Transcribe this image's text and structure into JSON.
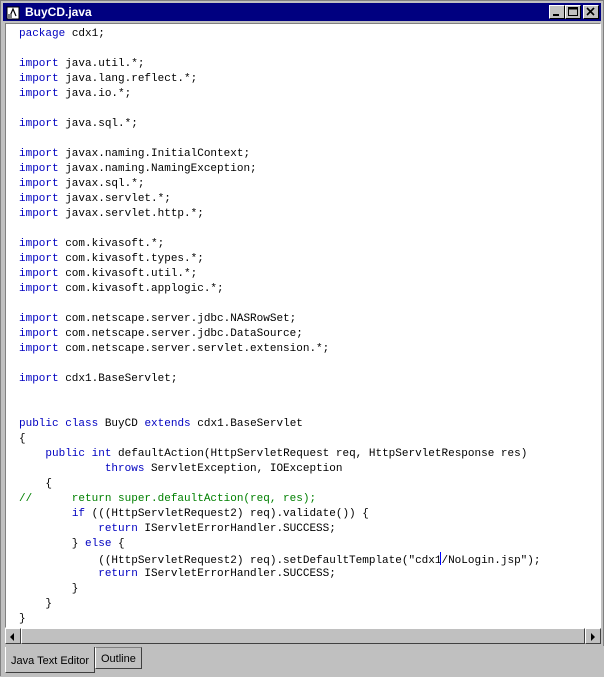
{
  "window": {
    "title": "BuyCD.java"
  },
  "tabs": [
    {
      "label": "Java Text Editor",
      "active": true
    },
    {
      "label": "Outline",
      "active": false
    }
  ],
  "code_lines": [
    [
      {
        "t": "package",
        "k": "kw"
      },
      {
        "t": " cdx1;"
      }
    ],
    [],
    [
      {
        "t": "import",
        "k": "kw"
      },
      {
        "t": " java.util.*;"
      }
    ],
    [
      {
        "t": "import",
        "k": "kw"
      },
      {
        "t": " java.lang.reflect.*;"
      }
    ],
    [
      {
        "t": "import",
        "k": "kw"
      },
      {
        "t": " java.io.*;"
      }
    ],
    [],
    [
      {
        "t": "import",
        "k": "kw"
      },
      {
        "t": " java.sql.*;"
      }
    ],
    [],
    [
      {
        "t": "import",
        "k": "kw"
      },
      {
        "t": " javax.naming.InitialContext;"
      }
    ],
    [
      {
        "t": "import",
        "k": "kw"
      },
      {
        "t": " javax.naming.NamingException;"
      }
    ],
    [
      {
        "t": "import",
        "k": "kw"
      },
      {
        "t": " javax.sql.*;"
      }
    ],
    [
      {
        "t": "import",
        "k": "kw"
      },
      {
        "t": " javax.servlet.*;"
      }
    ],
    [
      {
        "t": "import",
        "k": "kw"
      },
      {
        "t": " javax.servlet.http.*;"
      }
    ],
    [],
    [
      {
        "t": "import",
        "k": "kw"
      },
      {
        "t": " com.kivasoft.*;"
      }
    ],
    [
      {
        "t": "import",
        "k": "kw"
      },
      {
        "t": " com.kivasoft.types.*;"
      }
    ],
    [
      {
        "t": "import",
        "k": "kw"
      },
      {
        "t": " com.kivasoft.util.*;"
      }
    ],
    [
      {
        "t": "import",
        "k": "kw"
      },
      {
        "t": " com.kivasoft.applogic.*;"
      }
    ],
    [],
    [
      {
        "t": "import",
        "k": "kw"
      },
      {
        "t": " com.netscape.server.jdbc.NASRowSet;"
      }
    ],
    [
      {
        "t": "import",
        "k": "kw"
      },
      {
        "t": " com.netscape.server.jdbc.DataSource;"
      }
    ],
    [
      {
        "t": "import",
        "k": "kw"
      },
      {
        "t": " com.netscape.server.servlet.extension.*;"
      }
    ],
    [],
    [
      {
        "t": "import",
        "k": "kw"
      },
      {
        "t": " cdx1.BaseServlet;"
      }
    ],
    [],
    [],
    [
      {
        "t": "public",
        "k": "kw"
      },
      {
        "t": " "
      },
      {
        "t": "class",
        "k": "kw"
      },
      {
        "t": " BuyCD "
      },
      {
        "t": "extends",
        "k": "kw"
      },
      {
        "t": " cdx1.BaseServlet"
      }
    ],
    [
      {
        "t": "{"
      }
    ],
    [
      {
        "t": "    "
      },
      {
        "t": "public",
        "k": "kw"
      },
      {
        "t": " "
      },
      {
        "t": "int",
        "k": "kw"
      },
      {
        "t": " defaultAction(HttpServletRequest req, HttpServletResponse res)"
      }
    ],
    [
      {
        "t": "             "
      },
      {
        "t": "throws",
        "k": "kw"
      },
      {
        "t": " ServletException, IOException"
      }
    ],
    [
      {
        "t": "    {"
      }
    ],
    [
      {
        "t": "//      return super.defaultAction(req, res);",
        "k": "cm"
      }
    ],
    [
      {
        "t": "        "
      },
      {
        "t": "if",
        "k": "kw"
      },
      {
        "t": " (((HttpServletRequest2) req).validate()) {"
      }
    ],
    [
      {
        "t": "            "
      },
      {
        "t": "return",
        "k": "kw"
      },
      {
        "t": " IServletErrorHandler.SUCCESS;"
      }
    ],
    [
      {
        "t": "        } "
      },
      {
        "t": "else",
        "k": "kw"
      },
      {
        "t": " {"
      }
    ],
    [
      {
        "t": "            ((HttpServletRequest2) req).setDefaultTemplate(\"cdx1"
      },
      {
        "caret": true
      },
      {
        "t": "/NoLogin.jsp\");"
      }
    ],
    [
      {
        "t": "            "
      },
      {
        "t": "return",
        "k": "kw"
      },
      {
        "t": " IServletErrorHandler.SUCCESS;"
      }
    ],
    [
      {
        "t": "        }"
      }
    ],
    [
      {
        "t": "    }"
      }
    ],
    [
      {
        "t": "}"
      }
    ]
  ]
}
